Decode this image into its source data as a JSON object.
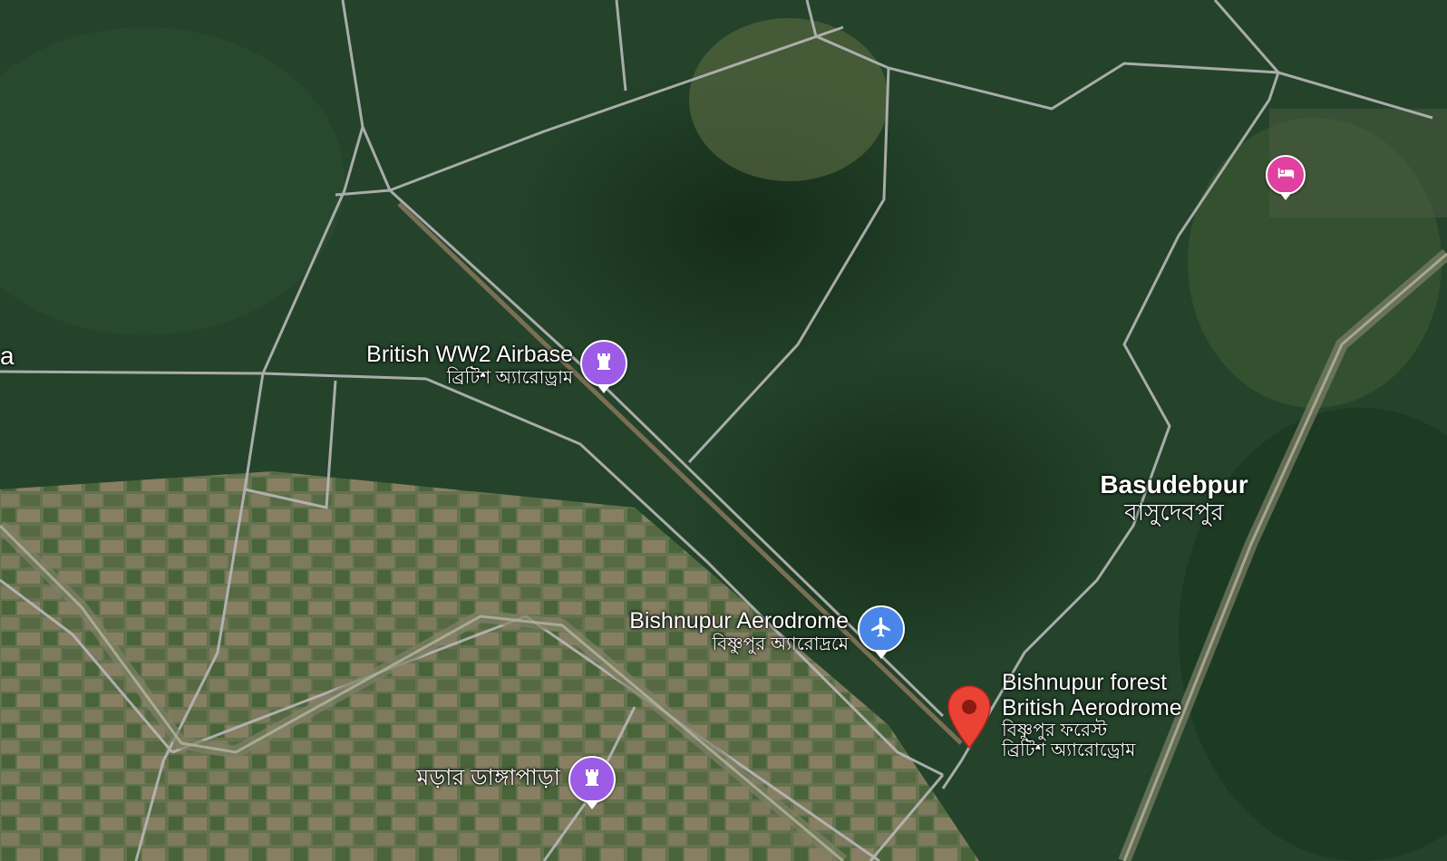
{
  "edge_label": "a",
  "pois": {
    "airbase": {
      "name": "British WW2 Airbase",
      "name_bn": "ব্রিটিশ অ্যারোড্রাম",
      "icon": "castle-icon",
      "color": "#9c5ce6"
    },
    "aerodrome": {
      "name": "Bishnupur Aerodrome",
      "name_bn": "বিষ্ণুপুর অ্যারোদ্রমে",
      "icon": "airplane-icon",
      "color": "#4a86e8"
    },
    "selected": {
      "name_line1": "Bishnupur forest",
      "name_line2": "British Aerodrome",
      "name_bn_line1": "বিষ্ণুপুর ফরেস্ট",
      "name_bn_line2": "ব্রিটিশ অ্যারোড্রোম",
      "icon": "red-location-pin-icon",
      "color": "#ea4335"
    },
    "morar": {
      "name": "মড়ার ডাঙ্গাপাড়া",
      "icon": "castle-icon",
      "color": "#9c5ce6"
    },
    "hotel": {
      "icon": "bed-icon",
      "color": "#e040a0"
    }
  },
  "place": {
    "name": "Basudebpur",
    "name_bn": "বাসুদেবপুর"
  }
}
